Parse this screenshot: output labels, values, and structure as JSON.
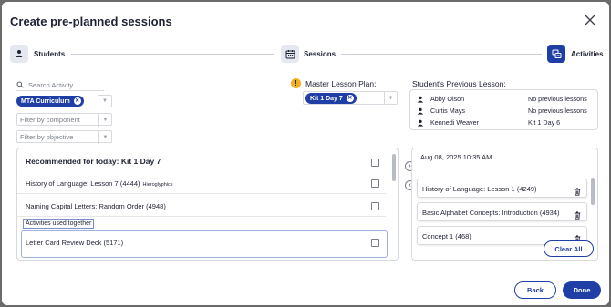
{
  "dialog": {
    "title": "Create pre-planned sessions",
    "close_icon": "close-icon"
  },
  "steps": [
    {
      "label": "Students",
      "icon": "person-icon",
      "active": false
    },
    {
      "label": "Sessions",
      "icon": "calendar-icon",
      "active": false
    },
    {
      "label": "Activities",
      "icon": "activities-icon",
      "active": true
    }
  ],
  "filters": {
    "search_placeholder": "Search Activity",
    "curriculum_chip": "MTA Curriculum",
    "component_placeholder": "Filter by component",
    "objective_placeholder": "Filter by objective"
  },
  "recommended": {
    "heading": "Recommended for today: Kit 1 Day 7",
    "items": [
      {
        "label": "History of Language: Lesson 7 (4444)",
        "tag": "Hieroglyphics",
        "checked": false
      },
      {
        "label": "Naming Capital Letters: Random Order (4948)",
        "tag": "",
        "checked": false
      }
    ],
    "used_together_label": "Activities used together",
    "used_together_items": [
      {
        "label": "Letter Card Review Deck (5171)",
        "checked": false
      }
    ]
  },
  "master_lesson_plan": {
    "label": "Master Lesson Plan:",
    "chip": "Kit 1 Day 7"
  },
  "previous_lesson": {
    "title": "Student's Previous Lesson:",
    "students": [
      {
        "name": "Abby Olson",
        "last": "No previous lessons"
      },
      {
        "name": "Curtis Mays",
        "last": "No previous lessons"
      },
      {
        "name": "Kennedi Weaver",
        "last": "Kit 1 Day 6"
      }
    ]
  },
  "session": {
    "date": "Aug 08, 2025 10:35 AM",
    "activities": [
      {
        "label": "History of Language: Lesson 1 (4249)"
      },
      {
        "label": "Basic Alphabet Concepts: Introduction (4934)"
      },
      {
        "label": "Concept 1 (468)"
      }
    ],
    "clear_all_label": "Clear All"
  },
  "footer": {
    "back_label": "Back",
    "done_label": "Done"
  },
  "colors": {
    "primary": "#1f3fa6",
    "warning": "#f2b01e",
    "step_inactive_bg": "#e6e8ef"
  }
}
